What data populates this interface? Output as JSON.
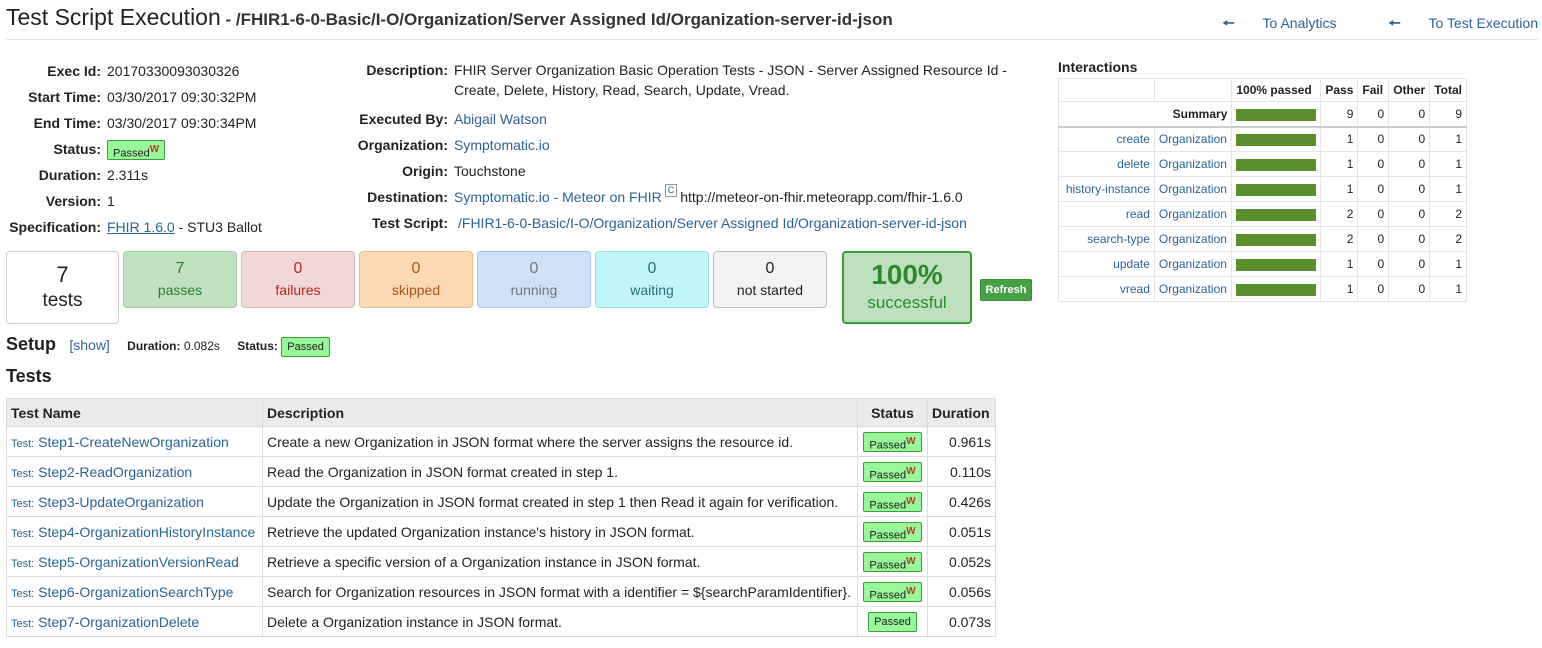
{
  "header": {
    "title": "Test Script Execution",
    "path": " - /FHIR1-6-0-Basic/I-O/Organization/Server Assigned Id/Organization-server-id-json",
    "nav": [
      {
        "icon": "arrow-left-icon",
        "label": "To Analytics"
      },
      {
        "icon": "arrow-left-icon",
        "label": "To Test Execution"
      }
    ]
  },
  "info": {
    "exec_id_label": "Exec Id:",
    "exec_id": "20170330093030326",
    "start_label": "Start Time:",
    "start": "03/30/2017 09:30:32PM",
    "end_label": "End Time:",
    "end": "03/30/2017 09:30:34PM",
    "status_label": "Status:",
    "status": "Passed",
    "status_mark": "W",
    "duration_label": "Duration:",
    "duration": "2.311s",
    "version_label": "Version:",
    "version": "1",
    "spec_label": "Specification:",
    "spec_link": "FHIR 1.6.0",
    "spec_rest": " - STU3 Ballot",
    "desc_label": "Description:",
    "desc": "FHIR Server Organization Basic Operation Tests - JSON - Server Assigned Resource Id - Create, Delete, History, Read, Search, Update, Vread.",
    "by_label": "Executed By:",
    "by": "Abigail Watson",
    "org_label": "Organization:",
    "org": "Symptomatic.io",
    "origin_label": "Origin:",
    "origin": "Touchstone",
    "dest_label": "Destination:",
    "dest": "Symptomatic.io - Meteor on FHIR",
    "dest_mark": "C",
    "dest_url": "http://meteor-on-fhir.meteorapp.com/fhir-1.6.0",
    "script_label": "Test Script:",
    "script": "/FHIR1-6-0-Basic/I-O/Organization/Server Assigned Id/Organization-server-id-json"
  },
  "counters": {
    "tests": "7",
    "tests_cap": "tests",
    "passes": "7",
    "passes_cap": "passes",
    "failures": "0",
    "failures_cap": "failures",
    "skipped": "0",
    "skipped_cap": "skipped",
    "running": "0",
    "running_cap": "running",
    "waiting": "0",
    "waiting_cap": "waiting",
    "not_started": "0",
    "not_started_cap": "not started",
    "success": "100%",
    "success_cap": "successful",
    "refresh": "Refresh"
  },
  "setup": {
    "heading": "Setup",
    "show": "[show]",
    "duration_label": "Duration:",
    "duration": "0.082s",
    "status_label": "Status:",
    "status": "Passed"
  },
  "tests": {
    "heading": "Tests",
    "columns": [
      "Test Name",
      "Description",
      "Status",
      "Duration"
    ],
    "prefix": "Test:",
    "rows": [
      {
        "name": "Step1-CreateNewOrganization",
        "desc": "Create a new Organization in JSON format where the server assigns the resource id.",
        "status": "Passed",
        "mark": "W",
        "dur": "0.961s"
      },
      {
        "name": "Step2-ReadOrganization",
        "desc": "Read the Organization in JSON format created in step 1.",
        "status": "Passed",
        "mark": "W",
        "dur": "0.110s"
      },
      {
        "name": "Step3-UpdateOrganization",
        "desc": "Update the Organization in JSON format created in step 1 then Read it again for verification.",
        "status": "Passed",
        "mark": "W",
        "dur": "0.426s"
      },
      {
        "name": "Step4-OrganizationHistoryInstance",
        "desc": "Retrieve the updated Organization instance's history in JSON format.",
        "status": "Passed",
        "mark": "W",
        "dur": "0.051s"
      },
      {
        "name": "Step5-OrganizationVersionRead",
        "desc": "Retrieve a specific version of a Organization instance in JSON format.",
        "status": "Passed",
        "mark": "W",
        "dur": "0.052s"
      },
      {
        "name": "Step6-OrganizationSearchType",
        "desc": "Search for Organization resources in JSON format with a identifier = ${searchParamIdentifier}.",
        "status": "Passed",
        "mark": "W",
        "dur": "0.056s"
      },
      {
        "name": "Step7-OrganizationDelete",
        "desc": "Delete a Organization instance in JSON format.",
        "status": "Passed",
        "mark": "",
        "dur": "0.073s"
      }
    ]
  },
  "interactions": {
    "heading": "Interactions",
    "columns": [
      "100% passed",
      "Pass",
      "Fail",
      "Other",
      "Total"
    ],
    "summary": {
      "label": "Summary",
      "pass": "9",
      "fail": "0",
      "other": "0",
      "total": "9",
      "passed_fraction": 1.0
    },
    "rows": [
      {
        "op": "create",
        "res": "Organization",
        "pass": "1",
        "fail": "0",
        "other": "0",
        "total": "1",
        "passed_fraction": 1.0
      },
      {
        "op": "delete",
        "res": "Organization",
        "pass": "1",
        "fail": "0",
        "other": "0",
        "total": "1",
        "passed_fraction": 1.0
      },
      {
        "op": "history-instance",
        "res": "Organization",
        "pass": "1",
        "fail": "0",
        "other": "0",
        "total": "1",
        "passed_fraction": 1.0
      },
      {
        "op": "read",
        "res": "Organization",
        "pass": "2",
        "fail": "0",
        "other": "0",
        "total": "2",
        "passed_fraction": 1.0
      },
      {
        "op": "search-type",
        "res": "Organization",
        "pass": "2",
        "fail": "0",
        "other": "0",
        "total": "2",
        "passed_fraction": 1.0
      },
      {
        "op": "update",
        "res": "Organization",
        "pass": "1",
        "fail": "0",
        "other": "0",
        "total": "1",
        "passed_fraction": 1.0
      },
      {
        "op": "vread",
        "res": "Organization",
        "pass": "1",
        "fail": "0",
        "other": "0",
        "total": "1",
        "passed_fraction": 1.0
      }
    ],
    "bar_color": "#5a8f2e"
  }
}
